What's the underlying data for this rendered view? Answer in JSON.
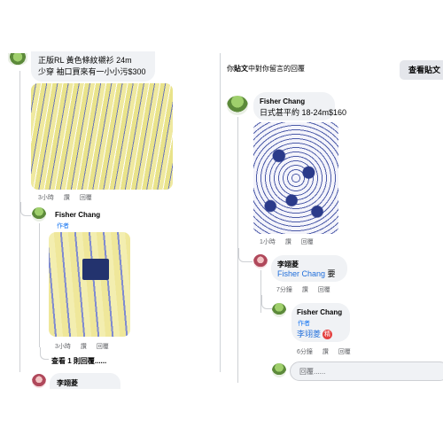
{
  "left": {
    "post_comment": {
      "text_line1": "正版RL 黃色條紋襯衫 24m",
      "text_line2": "少穿 袖口買來有一小小污$300",
      "meta": {
        "time": "3小時",
        "like": "讚",
        "reply": "回覆"
      }
    },
    "author_reply": {
      "name": "Fisher Chang",
      "author_label": "作者",
      "meta": {
        "time": "3小時",
        "like": "讚",
        "reply": "回覆"
      }
    },
    "view_more": "查看 1 則回覆......",
    "next_commenter": {
      "name": "李翊菱"
    }
  },
  "right": {
    "header": {
      "prefix": "你",
      "bold": "貼文",
      "suffix": "中對你留言的回覆",
      "view_post_button": "查看貼文"
    },
    "comment": {
      "name": "Fisher Chang",
      "text": "日式甚平約 18-24m$160",
      "meta": {
        "time": "1小時",
        "like": "讚",
        "reply": "回覆"
      }
    },
    "reply1": {
      "name": "李翊菱",
      "mention": "Fisher Chang",
      "text": "要",
      "meta": {
        "time": "7分鐘",
        "like": "讚",
        "reply": "回覆"
      }
    },
    "reply2": {
      "name": "Fisher Chang",
      "author_label": "作者",
      "mention": "李翊菱",
      "badge": "精",
      "meta": {
        "time": "6分鐘",
        "like": "讚",
        "reply": "回覆"
      }
    },
    "reply_input": {
      "placeholder": "回覆......"
    }
  },
  "colors": {
    "link": "#216fdb",
    "meta": "#65676b",
    "bubble": "#f0f2f5"
  }
}
